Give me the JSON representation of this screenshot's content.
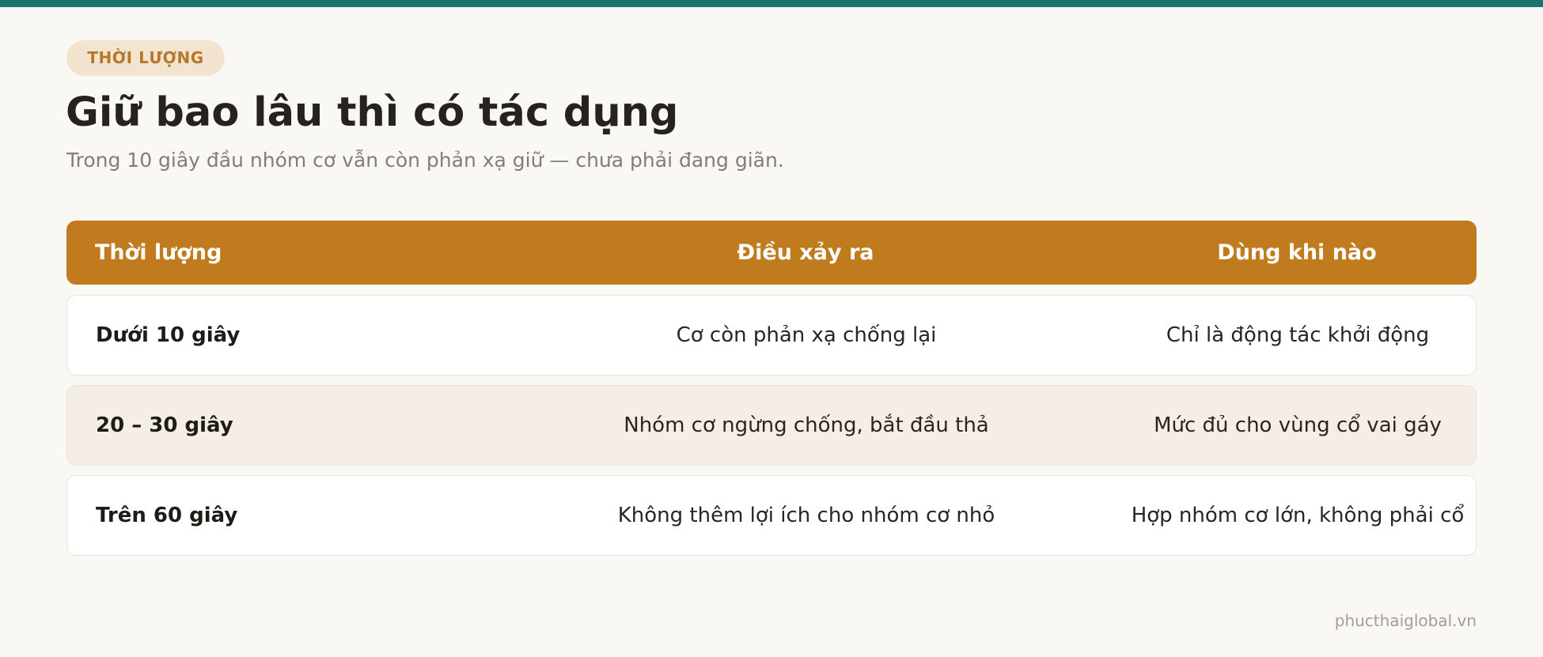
{
  "badge": "THỜI LƯỢNG",
  "title": "Giữ bao lâu thì có tác dụng",
  "subtitle": "Trong 10 giây đầu nhóm cơ vẫn còn phản xạ giữ — chưa phải đang giãn.",
  "table": {
    "headers": [
      "Thời lượng",
      "Điều xảy ra",
      "Dùng khi nào"
    ],
    "rows": [
      [
        "Dưới 10 giây",
        "Cơ còn phản xạ chống lại",
        "Chỉ là động tác khởi động"
      ],
      [
        "20 – 30 giây",
        "Nhóm cơ ngừng chống, bắt đầu thả",
        "Mức đủ cho vùng cổ vai gáy"
      ],
      [
        "Trên 60 giây",
        "Không thêm lợi ích cho nhóm cơ nhỏ",
        "Hợp nhóm cơ lớn, không phải cổ"
      ]
    ]
  },
  "footer": "phucthaiglobal.vn",
  "colors": {
    "accent_bar": "#17756d",
    "header_bg": "#c07b1f",
    "badge_bg": "#f3e4d0",
    "badge_text": "#b8772a",
    "page_bg": "#faf8f4",
    "alt_row_bg": "#f5eee6"
  }
}
